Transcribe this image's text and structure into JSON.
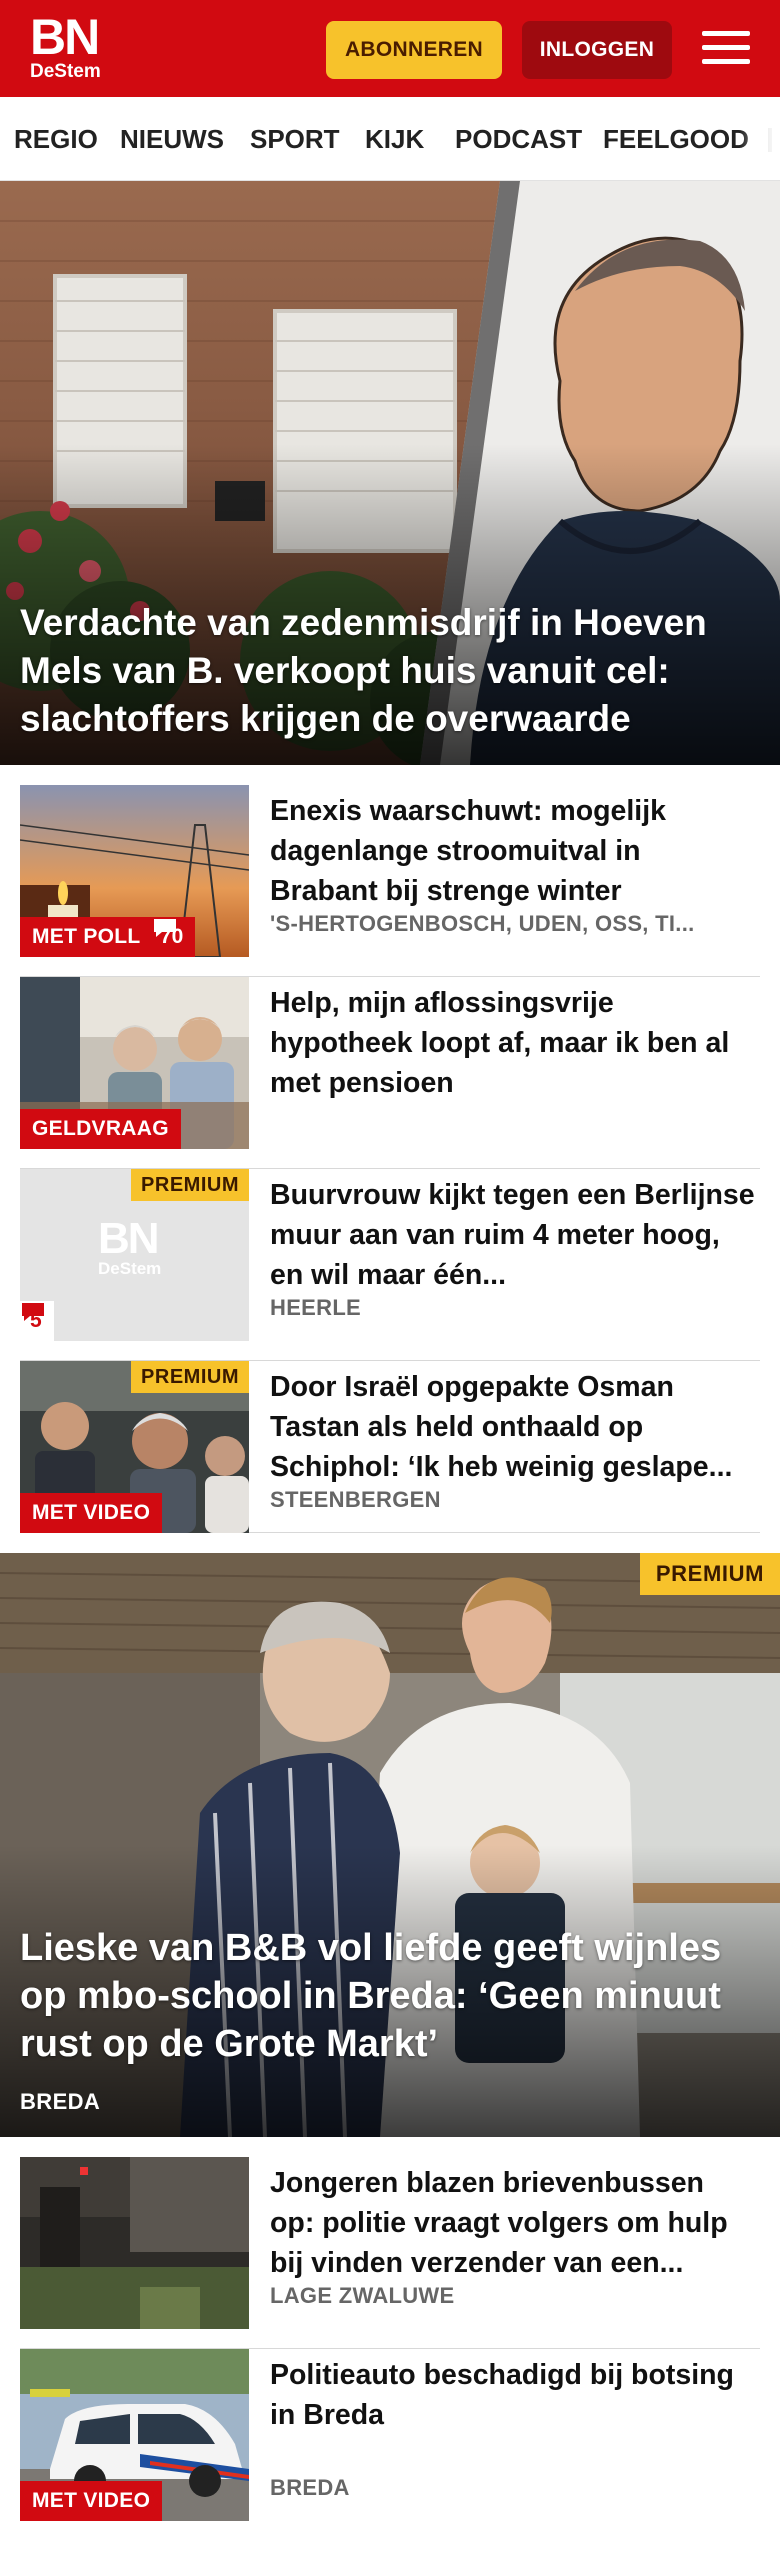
{
  "header": {
    "logo_main": "BN",
    "logo_sub": "DeStem",
    "subscribe_label": "ABONNEREN",
    "login_label": "INLOGGEN",
    "brand_color": "#d10a11",
    "subscribe_color": "#f7c22b"
  },
  "nav": {
    "items": [
      "REGIO",
      "NIEUWS",
      "SPORT",
      "KIJK",
      "PODCAST",
      "FEELGOOD"
    ]
  },
  "hero": {
    "title": "Verdachte van zedenmisdrijf in Hoeven Mels van B. verkoopt huis vanuit cel: slachtoffers krijgen de overwaarde"
  },
  "articles": [
    {
      "title": "Enexis waarschuwt: mogelijk dagenlange stroomuitval in Brabant bij strenge winter",
      "meta": "'S-HERTOGENBOSCH, UDEN, OSS, TI...",
      "label": "MET POLL",
      "comments": "70",
      "thumb_icon": "power-line-candle-image"
    },
    {
      "title": "Help, mijn aflossingsvrije hypotheek loopt af, maar ik ben al met pensioen",
      "meta": "",
      "label": "GELDVRAAG",
      "thumb_icon": "couple-consultation-image"
    },
    {
      "title": "Buurvrouw kijkt tegen een Berlijnse muur aan van ruim 4 meter hoog, en wil maar één...",
      "meta": "HEERLE",
      "premium": "PREMIUM",
      "comments": "5",
      "placeholder_logo_main": "BN",
      "placeholder_logo_sub": "DeStem"
    },
    {
      "title": "Door Israël opgepakte Osman Tastan als held onthaald op Schiphol: ‘Ik heb weinig geslape...",
      "meta": "STEENBERGEN",
      "premium": "PREMIUM",
      "label": "MET VIDEO",
      "thumb_icon": "airport-welcome-image"
    }
  ],
  "feature": {
    "premium": "PREMIUM",
    "title": "Lieske van B&B vol liefde geeft wijnles op mbo-school in Breda: ‘Geen minuut rust op de Grote Markt’",
    "meta": "BREDA"
  },
  "articles2": [
    {
      "title": "Jongeren blazen brievenbussen op: politie vraagt volgers om hulp bij vinden verzender van een...",
      "meta": "LAGE ZWALUWE",
      "thumb_icon": "cctv-still-image"
    },
    {
      "title": "Politieauto beschadigd bij botsing in Breda",
      "meta": "BREDA",
      "label": "MET VIDEO",
      "thumb_icon": "police-car-image"
    }
  ]
}
